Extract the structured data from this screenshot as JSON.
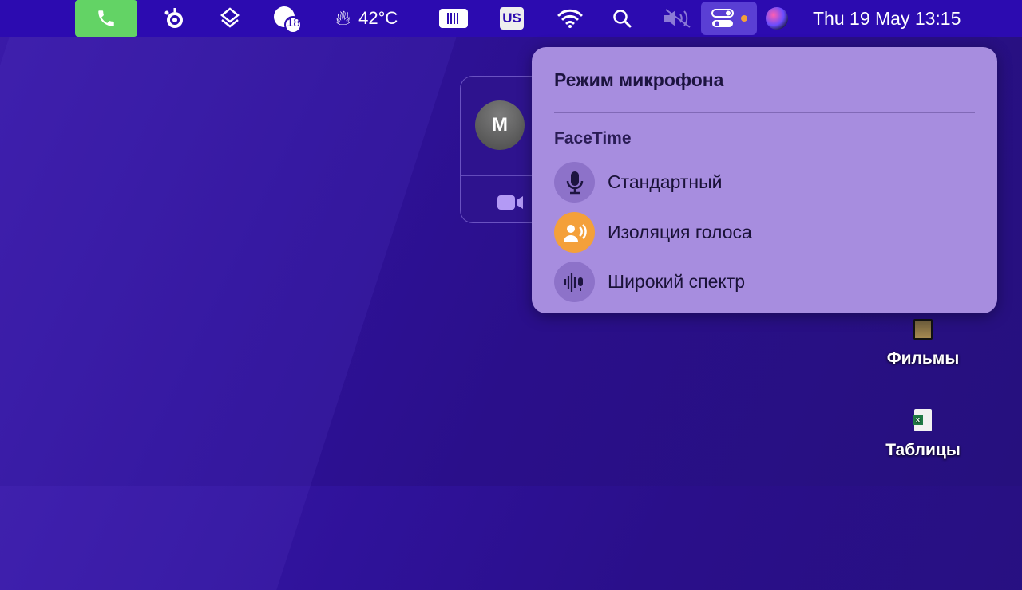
{
  "menubar": {
    "temperature": "42°C",
    "badge_count": "18",
    "keyboard_layout": "US",
    "datetime": "Thu 19 May  13:15"
  },
  "call_window": {
    "avatar_initial": "M"
  },
  "popup": {
    "title": "Режим микрофона",
    "section": "FaceTime",
    "options": [
      {
        "label": "Стандартный",
        "selected": false
      },
      {
        "label": "Изоляция голоса",
        "selected": true
      },
      {
        "label": "Широкий спектр",
        "selected": false
      }
    ]
  },
  "desktop": {
    "items": [
      {
        "label": "Фильмы"
      },
      {
        "label": "Таблицы"
      }
    ]
  },
  "colors": {
    "accent": "#f4a03a",
    "popup": "#a78ddf",
    "menubar": "#2c0bb0"
  }
}
